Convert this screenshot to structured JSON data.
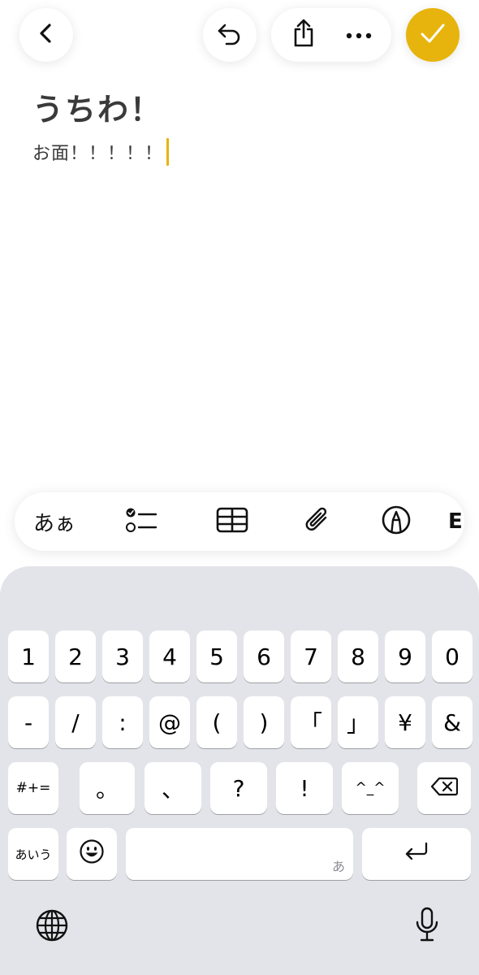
{
  "top_bar": {
    "back_icon": "chevron-left-icon",
    "undo_icon": "undo-icon",
    "share_icon": "share-icon",
    "more_icon": "more-horizontal-icon",
    "done_icon": "checkmark-icon",
    "accent_color": "#e6b40c"
  },
  "note": {
    "title": "うちわ！",
    "body": "お面！！！！！"
  },
  "toolbar": {
    "text_format_label": "あぁ",
    "checklist_icon": "checklist-icon",
    "table_icon": "table-icon",
    "attachment_icon": "paperclip-icon",
    "markup_icon": "pen-circle-icon",
    "overflow_partial_label": "E"
  },
  "keyboard": {
    "row1": [
      "1",
      "2",
      "3",
      "4",
      "5",
      "6",
      "7",
      "8",
      "9",
      "0"
    ],
    "row2": [
      "-",
      "/",
      ":",
      "@",
      "(",
      ")",
      "「",
      "」",
      "¥",
      "&"
    ],
    "row3": [
      "#+=",
      "。",
      "、",
      "?",
      "!",
      "^_^"
    ],
    "row4": {
      "mode_label": "あいう",
      "emoji_icon": "emoji-icon",
      "space_hint": "あ",
      "return_icon": "return-icon"
    },
    "delete_icon": "delete-icon",
    "globe_icon": "globe-icon",
    "mic_icon": "microphone-icon"
  }
}
